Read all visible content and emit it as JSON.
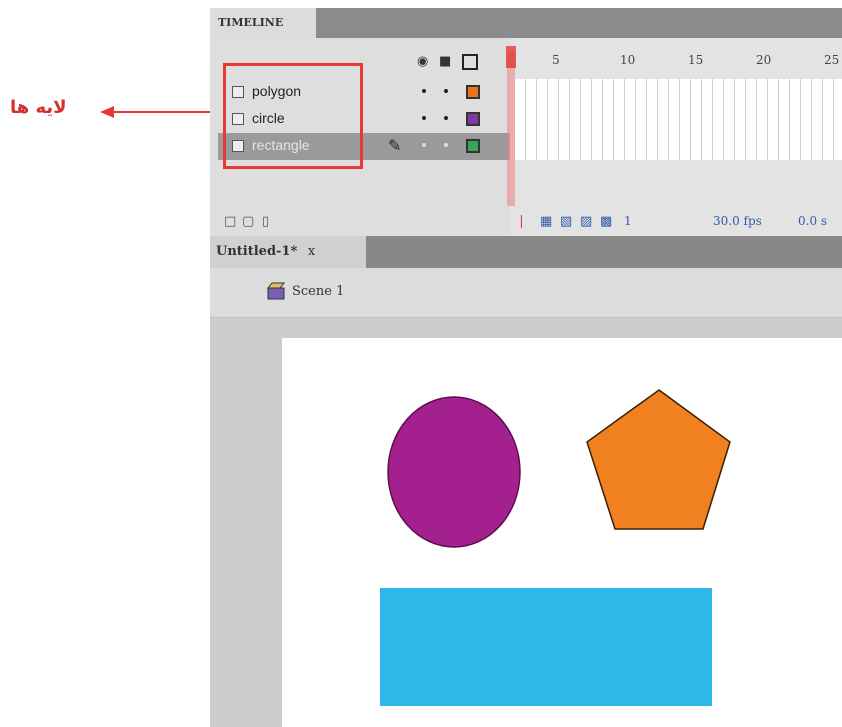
{
  "annotation": {
    "label": "لایه ها",
    "color": "#e53935"
  },
  "timeline": {
    "tab_label": "TIMELINE",
    "header_icons": [
      "eye-icon",
      "lock-icon",
      "outline-icon"
    ],
    "frame_numbers": [
      "5",
      "10",
      "15",
      "20",
      "25"
    ],
    "layers": [
      {
        "name": "polygon",
        "color": "#e8731a",
        "selected": false
      },
      {
        "name": "circle",
        "color": "#7b3aa5",
        "selected": false
      },
      {
        "name": "rectangle",
        "color": "#34a853",
        "selected": true
      }
    ],
    "current_frame": "1",
    "fps": "30.0 fps",
    "time": "0.0 s"
  },
  "document": {
    "tab_label": "Untitled-1*",
    "close_label": "x",
    "scene_label": "Scene 1"
  },
  "stage": {
    "shapes": [
      {
        "type": "ellipse",
        "color": "#a4208f"
      },
      {
        "type": "pentagon",
        "color": "#f08020"
      },
      {
        "type": "rectangle",
        "color": "#2fb8ea"
      }
    ]
  }
}
